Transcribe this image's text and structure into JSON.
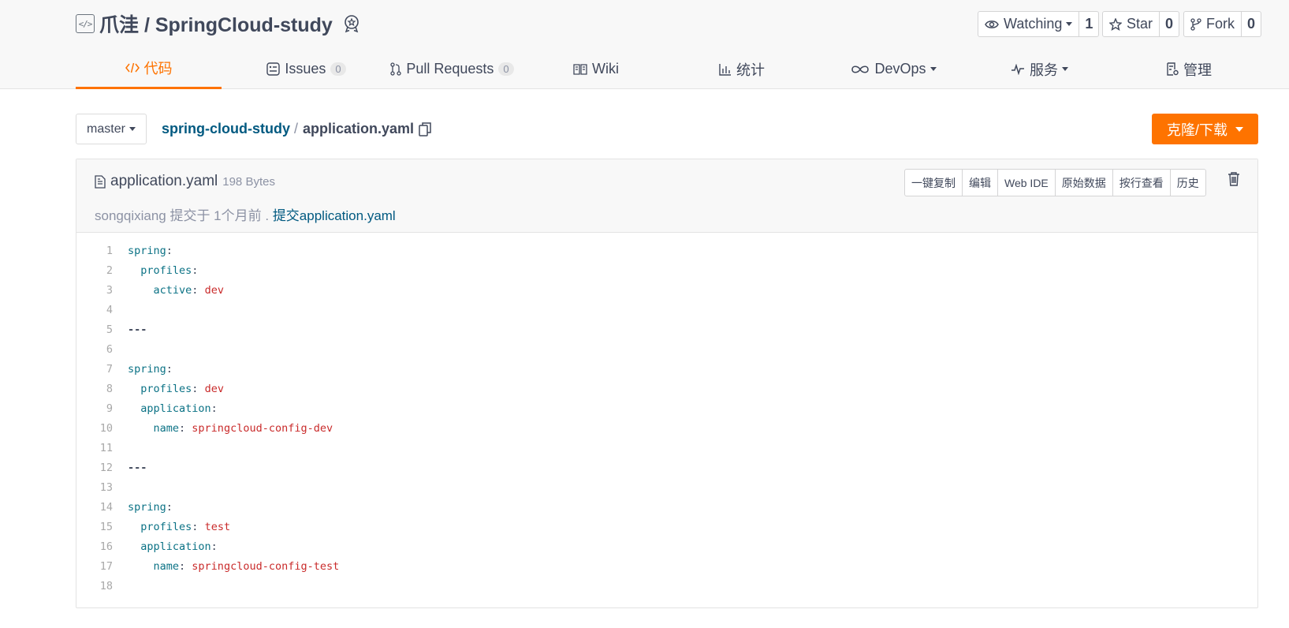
{
  "repo": {
    "title": "爪洼 / SpringCloud-study",
    "watch_label": "Watching",
    "watch_count": "1",
    "star_label": "Star",
    "star_count": "0",
    "fork_label": "Fork",
    "fork_count": "0"
  },
  "tabs": [
    {
      "label": "代码",
      "icon": "code-icon",
      "active": true
    },
    {
      "label": "Issues",
      "count": "0",
      "icon": "issues-icon"
    },
    {
      "label": "Pull Requests",
      "count": "0",
      "icon": "pull-request-icon"
    },
    {
      "label": "Wiki",
      "icon": "book-icon"
    },
    {
      "label": "统计",
      "icon": "bar-chart-icon"
    },
    {
      "label": "DevOps",
      "icon": "infinity-icon"
    },
    {
      "label": "服务",
      "icon": "pulse-icon"
    },
    {
      "label": "管理",
      "icon": "settings-doc-icon"
    }
  ],
  "toolbar": {
    "branch": "master",
    "path_root": "spring-cloud-study",
    "path_sep": "/",
    "path_file": "application.yaml",
    "clone_label": "克隆/下载"
  },
  "file": {
    "name": "application.yaml",
    "size": "198 Bytes",
    "commit_prefix": "songqixiang 提交于 1个月前 . ",
    "commit_message": "提交application.yaml",
    "buttons": [
      "一键复制",
      "编辑",
      "Web IDE",
      "原始数据",
      "按行查看",
      "历史"
    ]
  },
  "code_lines": [
    {
      "n": "1",
      "t": "spring:"
    },
    {
      "n": "2",
      "t": "  profiles:"
    },
    {
      "n": "3",
      "t": "    active: dev"
    },
    {
      "n": "4",
      "t": ""
    },
    {
      "n": "5",
      "t": "---"
    },
    {
      "n": "6",
      "t": ""
    },
    {
      "n": "7",
      "t": "spring:"
    },
    {
      "n": "8",
      "t": "  profiles: dev"
    },
    {
      "n": "9",
      "t": "  application:"
    },
    {
      "n": "10",
      "t": "    name: springcloud-config-dev"
    },
    {
      "n": "11",
      "t": ""
    },
    {
      "n": "12",
      "t": "---"
    },
    {
      "n": "13",
      "t": ""
    },
    {
      "n": "14",
      "t": "spring:"
    },
    {
      "n": "15",
      "t": "  profiles: test"
    },
    {
      "n": "16",
      "t": "  application:"
    },
    {
      "n": "17",
      "t": "    name: springcloud-config-test"
    },
    {
      "n": "18",
      "t": ""
    }
  ],
  "colors": {
    "accent": "#fe7300",
    "link": "#005980",
    "key": "#0b7285",
    "value": "#c92a2a"
  }
}
